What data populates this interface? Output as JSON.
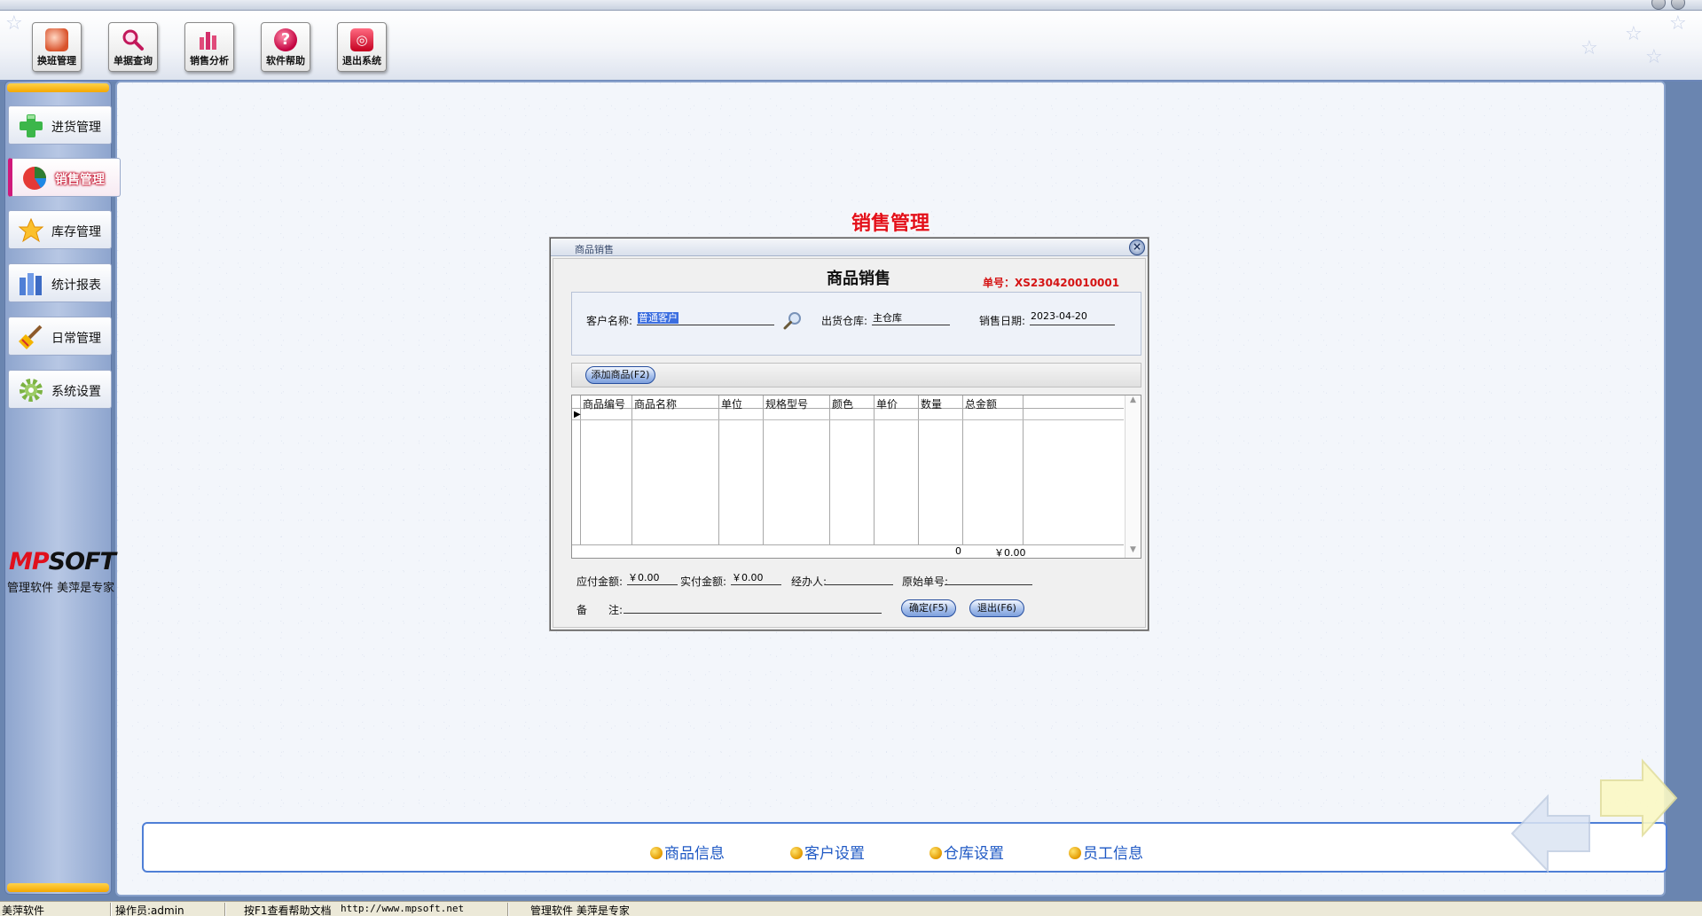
{
  "toolbar": {
    "buttons": [
      {
        "label": "换班管理",
        "icon": "shift-icon"
      },
      {
        "label": "单据查询",
        "icon": "search-icon"
      },
      {
        "label": "销售分析",
        "icon": "bar-chart-icon"
      },
      {
        "label": "软件帮助",
        "icon": "help-icon"
      },
      {
        "label": "退出系统",
        "icon": "power-icon"
      }
    ]
  },
  "sidebar": {
    "items": [
      {
        "label": "进货管理",
        "icon": "plus-icon"
      },
      {
        "label": "销售管理",
        "icon": "pie-chart-icon",
        "active": true
      },
      {
        "label": "库存管理",
        "icon": "star-icon"
      },
      {
        "label": "统计报表",
        "icon": "report-icon"
      },
      {
        "label": "日常管理",
        "icon": "broom-icon"
      },
      {
        "label": "系统设置",
        "icon": "gear-icon"
      }
    ],
    "brand_logo": "MPSOFT",
    "brand_sub": "管理软件 美萍是专家"
  },
  "page_heading": "销售管理",
  "dialog": {
    "window_title": "商品销售",
    "form_title": "商品销售",
    "order_no": "单号：XS230420010001",
    "customer_label": "客户名称:",
    "customer_value": "普通客户",
    "warehouse_label": "出货仓库:",
    "warehouse_value": "主仓库",
    "date_label": "销售日期:",
    "date_value": "2023-04-20",
    "add_product_button": "添加商品(F2)",
    "grid": {
      "columns": [
        "商品编号",
        "商品名称",
        "单位",
        "规格型号",
        "颜色",
        "单价",
        "数量",
        "总金额"
      ],
      "rows": [],
      "total_quantity": "0",
      "total_amount": "￥0.00"
    },
    "payable_label": "应付金额:",
    "payable_value": "￥0.00",
    "paid_label": "实付金额:",
    "paid_value": "￥0.00",
    "handler_label": "经办人:",
    "handler_value": "",
    "orig_no_label": "原始单号:",
    "orig_no_value": "",
    "remark_label": "备　　注:",
    "remark_value": "",
    "confirm_button": "确定(F5)",
    "exit_button": "退出(F6)"
  },
  "quickbar": {
    "items": [
      "商品信息",
      "客户设置",
      "仓库设置",
      "员工信息"
    ]
  },
  "statusbar": {
    "company": "美萍软件",
    "operator": "操作员:admin",
    "help": "按F1查看帮助文档",
    "url": "http://www.mpsoft.net",
    "slogan": "管理软件 美萍是专家"
  },
  "colors": {
    "accent": "#4f7fd6",
    "heading_red": "#e3101a",
    "active_marker": "#d0187a"
  }
}
